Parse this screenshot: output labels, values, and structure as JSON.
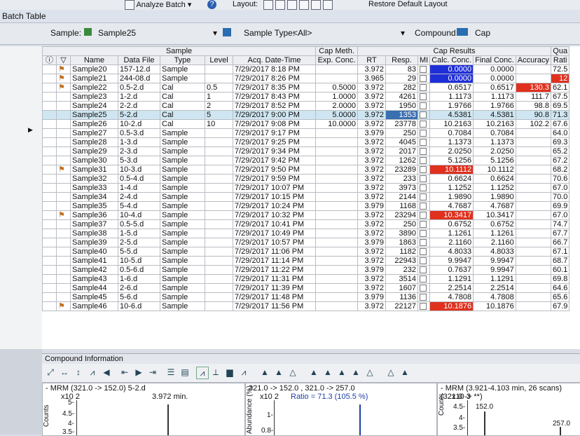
{
  "toolbar": {
    "analyze_batch": "Analyze Batch",
    "layout": "Layout:",
    "restore_layout": "Restore Default Layout"
  },
  "batch_table_title": "Batch Table",
  "filters": {
    "sample_label": "Sample:",
    "sample_value": "Sample25",
    "sample_type_label": "Sample Type:",
    "sample_type_value": "<All>",
    "compound_label": "Compound:",
    "compound_value": "Cap"
  },
  "groups": {
    "sample": "Sample",
    "cap_meth": "Cap Meth.",
    "cap_results": "Cap Results",
    "qual": "Qua"
  },
  "columns": [
    "Name",
    "Data File",
    "Type",
    "Level",
    "Acq. Date-Time",
    "Exp. Conc.",
    "RT",
    "Resp.",
    "MI",
    "Calc. Conc.",
    "Final Conc.",
    "Accuracy",
    "Rati"
  ],
  "rows": [
    {
      "flag": true,
      "name": "Sample20",
      "file": "157-12.d",
      "type": "Sample",
      "level": "",
      "date": "7/29/2017 8:18 PM",
      "exp": "",
      "rt": "3.972",
      "resp": "83",
      "calc": "0.0000",
      "final": "0.0000",
      "acc": "",
      "ratio": "72.5",
      "calc_style": "blue",
      "acc_style": ""
    },
    {
      "flag": true,
      "name": "Sample21",
      "file": "244-08.d",
      "type": "Sample",
      "level": "",
      "date": "7/29/2017 8:26 PM",
      "exp": "",
      "rt": "3.965",
      "resp": "29",
      "calc": "0.0000",
      "final": "0.0000",
      "acc": "",
      "ratio": "12",
      "calc_style": "blue",
      "acc_style": "",
      "ratio_style": "red"
    },
    {
      "flag": true,
      "name": "Sample22",
      "file": "0.5-2.d",
      "type": "Cal",
      "level": "0.5",
      "date": "7/29/2017 8:35 PM",
      "exp": "0.5000",
      "rt": "3.972",
      "resp": "282",
      "calc": "0.6517",
      "final": "0.6517",
      "acc": "130.3",
      "ratio": "62.1",
      "calc_style": "",
      "acc_style": "red"
    },
    {
      "flag": false,
      "name": "Sample23",
      "file": "1-2.d",
      "type": "Cal",
      "level": "1",
      "date": "7/29/2017 8:43 PM",
      "exp": "1.0000",
      "rt": "3.972",
      "resp": "4261",
      "calc": "1.1173",
      "final": "1.1173",
      "acc": "111.7",
      "ratio": "67.5",
      "calc_style": "",
      "acc_style": ""
    },
    {
      "flag": false,
      "name": "Sample24",
      "file": "2-2.d",
      "type": "Cal",
      "level": "2",
      "date": "7/29/2017 8:52 PM",
      "exp": "2.0000",
      "rt": "3.972",
      "resp": "1950",
      "calc": "1.9766",
      "final": "1.9766",
      "acc": "98.8",
      "ratio": "69.5",
      "calc_style": "",
      "acc_style": ""
    },
    {
      "flag": false,
      "name": "Sample25",
      "file": "5-2.d",
      "type": "Cal",
      "level": "5",
      "date": "7/29/2017 9:00 PM",
      "exp": "5.0000",
      "rt": "3.972",
      "resp": "1353",
      "calc": "4.5381",
      "final": "4.5381",
      "acc": "90.8",
      "ratio": "71.3",
      "calc_style": "",
      "acc_style": "",
      "selected": true
    },
    {
      "flag": false,
      "name": "Sample26",
      "file": "10-2.d",
      "type": "Cal",
      "level": "10",
      "date": "7/29/2017 9:08 PM",
      "exp": "10.0000",
      "rt": "3.972",
      "resp": "23778",
      "calc": "10.2163",
      "final": "10.2163",
      "acc": "102.2",
      "ratio": "67.6",
      "calc_style": "",
      "acc_style": ""
    },
    {
      "flag": false,
      "name": "Sample27",
      "file": "0.5-3.d",
      "type": "Sample",
      "level": "",
      "date": "7/29/2017 9:17 PM",
      "exp": "",
      "rt": "3.979",
      "resp": "250",
      "calc": "0.7084",
      "final": "0.7084",
      "acc": "",
      "ratio": "64.0",
      "calc_style": "",
      "acc_style": ""
    },
    {
      "flag": false,
      "name": "Sample28",
      "file": "1-3.d",
      "type": "Sample",
      "level": "",
      "date": "7/29/2017 9:25 PM",
      "exp": "",
      "rt": "3.972",
      "resp": "4045",
      "calc": "1.1373",
      "final": "1.1373",
      "acc": "",
      "ratio": "69.3",
      "calc_style": "",
      "acc_style": ""
    },
    {
      "flag": false,
      "name": "Sample29",
      "file": "2-3.d",
      "type": "Sample",
      "level": "",
      "date": "7/29/2017 9:34 PM",
      "exp": "",
      "rt": "3.972",
      "resp": "2017",
      "calc": "2.0250",
      "final": "2.0250",
      "acc": "",
      "ratio": "65.2",
      "calc_style": "",
      "acc_style": ""
    },
    {
      "flag": false,
      "name": "Sample30",
      "file": "5-3.d",
      "type": "Sample",
      "level": "",
      "date": "7/29/2017 9:42 PM",
      "exp": "",
      "rt": "3.972",
      "resp": "1262",
      "calc": "5.1256",
      "final": "5.1256",
      "acc": "",
      "ratio": "67.2",
      "calc_style": "",
      "acc_style": ""
    },
    {
      "flag": true,
      "name": "Sample31",
      "file": "10-3.d",
      "type": "Sample",
      "level": "",
      "date": "7/29/2017 9:50 PM",
      "exp": "",
      "rt": "3.972",
      "resp": "23289",
      "calc": "10.1112",
      "final": "10.1112",
      "acc": "",
      "ratio": "68.2",
      "calc_style": "red",
      "acc_style": ""
    },
    {
      "flag": false,
      "name": "Sample32",
      "file": "0.5-4.d",
      "type": "Sample",
      "level": "",
      "date": "7/29/2017 9:59 PM",
      "exp": "",
      "rt": "3.972",
      "resp": "233",
      "calc": "0.6624",
      "final": "0.6624",
      "acc": "",
      "ratio": "70.6",
      "calc_style": "",
      "acc_style": ""
    },
    {
      "flag": false,
      "name": "Sample33",
      "file": "1-4.d",
      "type": "Sample",
      "level": "",
      "date": "7/29/2017 10:07 PM",
      "exp": "",
      "rt": "3.972",
      "resp": "3973",
      "calc": "1.1252",
      "final": "1.1252",
      "acc": "",
      "ratio": "67.0",
      "calc_style": "",
      "acc_style": ""
    },
    {
      "flag": false,
      "name": "Sample34",
      "file": "2-4.d",
      "type": "Sample",
      "level": "",
      "date": "7/29/2017 10:15 PM",
      "exp": "",
      "rt": "3.972",
      "resp": "2144",
      "calc": "1.9890",
      "final": "1.9890",
      "acc": "",
      "ratio": "70.0",
      "calc_style": "",
      "acc_style": ""
    },
    {
      "flag": false,
      "name": "Sample35",
      "file": "5-4.d",
      "type": "Sample",
      "level": "",
      "date": "7/29/2017 10:24 PM",
      "exp": "",
      "rt": "3.979",
      "resp": "1168",
      "calc": "4.7687",
      "final": "4.7687",
      "acc": "",
      "ratio": "69.9",
      "calc_style": "",
      "acc_style": ""
    },
    {
      "flag": true,
      "name": "Sample36",
      "file": "10-4.d",
      "type": "Sample",
      "level": "",
      "date": "7/29/2017 10:32 PM",
      "exp": "",
      "rt": "3.972",
      "resp": "23294",
      "calc": "10.3417",
      "final": "10.3417",
      "acc": "",
      "ratio": "67.0",
      "calc_style": "red",
      "acc_style": ""
    },
    {
      "flag": false,
      "name": "Sample37",
      "file": "0.5-5.d",
      "type": "Sample",
      "level": "",
      "date": "7/29/2017 10:41 PM",
      "exp": "",
      "rt": "3.972",
      "resp": "250",
      "calc": "0.6752",
      "final": "0.6752",
      "acc": "",
      "ratio": "74.7",
      "calc_style": "",
      "acc_style": ""
    },
    {
      "flag": false,
      "name": "Sample38",
      "file": "1-5.d",
      "type": "Sample",
      "level": "",
      "date": "7/29/2017 10:49 PM",
      "exp": "",
      "rt": "3.972",
      "resp": "3890",
      "calc": "1.1261",
      "final": "1.1261",
      "acc": "",
      "ratio": "67.7",
      "calc_style": "",
      "acc_style": ""
    },
    {
      "flag": false,
      "name": "Sample39",
      "file": "2-5.d",
      "type": "Sample",
      "level": "",
      "date": "7/29/2017 10:57 PM",
      "exp": "",
      "rt": "3.979",
      "resp": "1863",
      "calc": "2.1160",
      "final": "2.1160",
      "acc": "",
      "ratio": "66.7",
      "calc_style": "",
      "acc_style": ""
    },
    {
      "flag": false,
      "name": "Sample40",
      "file": "5-5.d",
      "type": "Sample",
      "level": "",
      "date": "7/29/2017 11:06 PM",
      "exp": "",
      "rt": "3.972",
      "resp": "1182",
      "calc": "4.8033",
      "final": "4.8033",
      "acc": "",
      "ratio": "67.1",
      "calc_style": "",
      "acc_style": ""
    },
    {
      "flag": false,
      "name": "Sample41",
      "file": "10-5.d",
      "type": "Sample",
      "level": "",
      "date": "7/29/2017 11:14 PM",
      "exp": "",
      "rt": "3.972",
      "resp": "22943",
      "calc": "9.9947",
      "final": "9.9947",
      "acc": "",
      "ratio": "68.7",
      "calc_style": "",
      "acc_style": ""
    },
    {
      "flag": false,
      "name": "Sample42",
      "file": "0.5-6.d",
      "type": "Sample",
      "level": "",
      "date": "7/29/2017 11:22 PM",
      "exp": "",
      "rt": "3.979",
      "resp": "232",
      "calc": "0.7637",
      "final": "9.9947",
      "acc": "",
      "ratio": "60.1",
      "calc_style": "",
      "acc_style": ""
    },
    {
      "flag": false,
      "name": "Sample43",
      "file": "1-6.d",
      "type": "Sample",
      "level": "",
      "date": "7/29/2017 11:31 PM",
      "exp": "",
      "rt": "3.972",
      "resp": "3514",
      "calc": "1.1291",
      "final": "1.1291",
      "acc": "",
      "ratio": "69.8",
      "calc_style": "",
      "acc_style": ""
    },
    {
      "flag": false,
      "name": "Sample44",
      "file": "2-6.d",
      "type": "Sample",
      "level": "",
      "date": "7/29/2017 11:39 PM",
      "exp": "",
      "rt": "3.972",
      "resp": "1607",
      "calc": "2.2514",
      "final": "2.2514",
      "acc": "",
      "ratio": "64.6",
      "calc_style": "",
      "acc_style": ""
    },
    {
      "flag": false,
      "name": "Sample45",
      "file": "5-6.d",
      "type": "Sample",
      "level": "",
      "date": "7/29/2017 11:48 PM",
      "exp": "",
      "rt": "3.979",
      "resp": "1136",
      "calc": "4.7808",
      "final": "4.7808",
      "acc": "",
      "ratio": "65.6",
      "calc_style": "",
      "acc_style": ""
    },
    {
      "flag": true,
      "name": "Sample46",
      "file": "10-6.d",
      "type": "Sample",
      "level": "",
      "date": "7/29/2017 11:56 PM",
      "exp": "",
      "rt": "3.972",
      "resp": "22127",
      "calc": "10.1876",
      "final": "10.1876",
      "acc": "",
      "ratio": "67.9",
      "calc_style": "red",
      "acc_style": ""
    }
  ],
  "compound_info": "Compound Information",
  "panels": {
    "left_title": "- MRM (321.0 -> 152.0) 5-2.d",
    "left_scale": "x10 2",
    "left_rt": "3.972 min.",
    "left_y1": "5-",
    "left_y2": "4.5-",
    "left_y3": "4-",
    "left_y4": "3.5-",
    "left_axis": "Counts",
    "mid_title": "321.0 -> 152.0 , 321.0 -> 257.0",
    "mid_scale": "x10 2",
    "mid_ratio": "Ratio = 71.3 (105.5 %)",
    "mid_y1": "1-",
    "mid_y2": "0.8-",
    "mid_axis": "Abundance (%)",
    "right_title": "- MRM (3.921-4.103 min, 26 scans) (321.0 -> **)",
    "right_scale": "x10 3",
    "right_y1": "4.5-",
    "right_y2": "4-",
    "right_y3": "3.5-",
    "right_peak1": "152.0",
    "right_peak2": "257.0",
    "right_axis": "Counts"
  },
  "colors": {
    "blue_cell": "#1f2fd8",
    "red_cell": "#e0301e",
    "selected_row": "#cfe6f2"
  }
}
